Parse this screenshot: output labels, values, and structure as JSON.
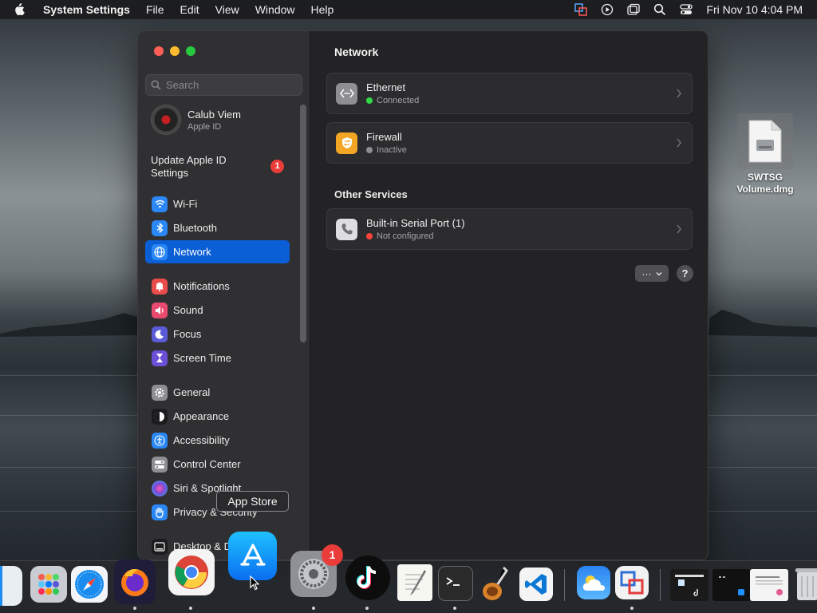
{
  "menubar": {
    "app_name": "System Settings",
    "items": [
      "File",
      "Edit",
      "View",
      "Window",
      "Help"
    ],
    "clock": "Fri Nov 10  4:04 PM"
  },
  "sidebar": {
    "search_placeholder": "Search",
    "account": {
      "name": "Calub Viem",
      "subtitle": "Apple ID"
    },
    "update": {
      "label": "Update Apple ID Settings",
      "badge": "1"
    },
    "items": [
      {
        "label": "Wi-Fi",
        "icon": "wifi-icon",
        "color": "#2a87f5"
      },
      {
        "label": "Bluetooth",
        "icon": "bluetooth-icon",
        "color": "#2a87f5"
      },
      {
        "label": "Network",
        "icon": "globe-icon",
        "color": "#2a87f5"
      },
      {
        "label": "Notifications",
        "icon": "bell-icon",
        "color": "#ea4b4b"
      },
      {
        "label": "Sound",
        "icon": "speaker-icon",
        "color": "#e94a6e"
      },
      {
        "label": "Focus",
        "icon": "moon-icon",
        "color": "#5a5bd6"
      },
      {
        "label": "Screen Time",
        "icon": "hourglass-icon",
        "color": "#6b4fd6"
      },
      {
        "label": "General",
        "icon": "gear-icon",
        "color": "#8e8e93"
      },
      {
        "label": "Appearance",
        "icon": "appearance-icon",
        "color": "#1c1c1e"
      },
      {
        "label": "Accessibility",
        "icon": "accessibility-icon",
        "color": "#2a87f5"
      },
      {
        "label": "Control Center",
        "icon": "control-center-icon",
        "color": "#8e8e93"
      },
      {
        "label": "Siri & Spotlight",
        "icon": "siri-icon",
        "color": "#7a49d8"
      },
      {
        "label": "Privacy & Security",
        "icon": "hand-icon",
        "color": "#2a87f5"
      },
      {
        "label": "Desktop & Dock",
        "icon": "desktop-icon",
        "color": "#1c1c1e"
      }
    ],
    "selected": "Network"
  },
  "main": {
    "title": "Network",
    "services": [
      {
        "name": "Ethernet",
        "status": "Connected",
        "status_color": "#32d74b",
        "icon": "ethernet-icon"
      },
      {
        "name": "Firewall",
        "status": "Inactive",
        "status_color": "#8e8e93",
        "icon": "firewall-icon"
      }
    ],
    "other_title": "Other Services",
    "other_services": [
      {
        "name": "Built-in Serial Port (1)",
        "status": "Not configured",
        "status_color": "#ff453a",
        "icon": "phone-icon"
      }
    ],
    "more_label": "···",
    "help_label": "?"
  },
  "desktop_file": {
    "label": "SWTSG Volume.dmg"
  },
  "tooltip": "App Store",
  "dock": {
    "settings_badge": "1",
    "apps": [
      "Finder",
      "Launchpad",
      "Safari",
      "Firefox",
      "Chrome",
      "App Store",
      "System Settings",
      "TikTok",
      "TextEdit",
      "Terminal",
      "GarageBand",
      "Visual Studio Code",
      "Weather",
      "Parallels",
      "Window Preview",
      "Window Preview 2",
      "Window Preview 3",
      "Trash"
    ]
  }
}
